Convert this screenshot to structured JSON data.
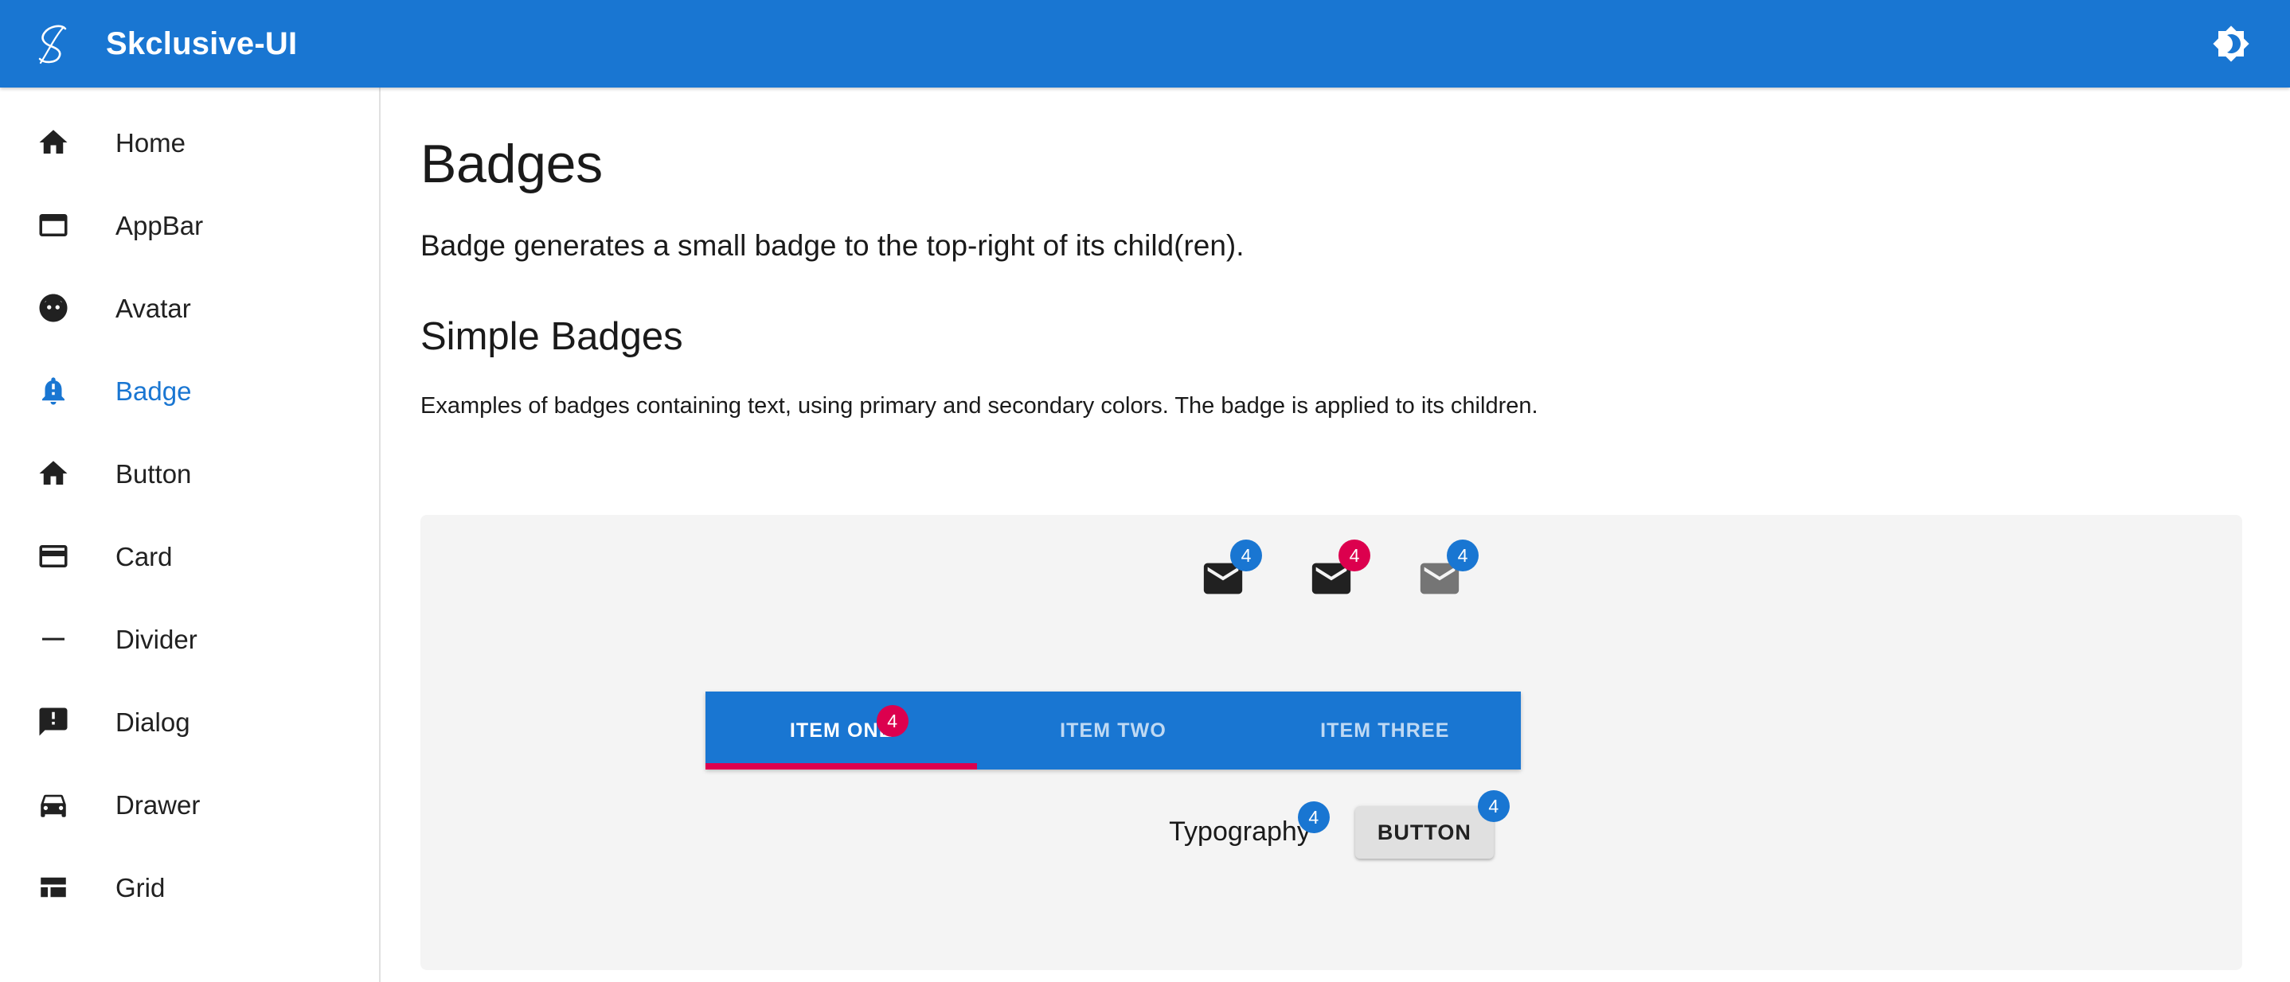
{
  "appbar": {
    "logo_icon": "script-s-logo-icon",
    "title": "Skclusive-UI",
    "theme_toggle_icon": "brightness-dark-mode-icon",
    "background_color": "#1976d2"
  },
  "sidebar": {
    "items": [
      {
        "label": "Home",
        "icon": "home-icon",
        "active": false
      },
      {
        "label": "AppBar",
        "icon": "web-asset-icon",
        "active": false
      },
      {
        "label": "Avatar",
        "icon": "face-icon",
        "active": false
      },
      {
        "label": "Badge",
        "icon": "notification-bell-icon",
        "active": true
      },
      {
        "label": "Button",
        "icon": "home-icon",
        "active": false
      },
      {
        "label": "Card",
        "icon": "credit-card-icon",
        "active": false
      },
      {
        "label": "Divider",
        "icon": "horizontal-rule-icon",
        "active": false
      },
      {
        "label": "Dialog",
        "icon": "comment-alert-icon",
        "active": false
      },
      {
        "label": "Drawer",
        "icon": "directions-car-icon",
        "active": false
      },
      {
        "label": "Grid",
        "icon": "dashboard-grid-icon",
        "active": false
      }
    ],
    "active_color": "#1976d2"
  },
  "main": {
    "page_title": "Badges",
    "page_description": "Badge generates a small badge to the top-right of its child(ren).",
    "section_title": "Simple Badges",
    "section_description": "Examples of badges containing text, using primary and secondary colors. The badge is applied to its children."
  },
  "demo": {
    "mail_badges": [
      {
        "icon": "mail-icon",
        "badge_value": "4",
        "badge_color_name": "primary",
        "badge_color": "#1976d2",
        "icon_state": "normal"
      },
      {
        "icon": "mail-icon",
        "badge_value": "4",
        "badge_color_name": "secondary",
        "badge_color": "#dc004e",
        "icon_state": "normal"
      },
      {
        "icon": "mail-icon",
        "badge_value": "4",
        "badge_color_name": "primary",
        "badge_color": "#1976d2",
        "icon_state": "disabled"
      }
    ],
    "tabs": {
      "items": [
        {
          "label": "ITEM ONE",
          "active": true,
          "badge_value": "4",
          "badge_color": "#dc004e"
        },
        {
          "label": "ITEM TWO",
          "active": false,
          "badge_value": "",
          "badge_color": ""
        },
        {
          "label": "ITEM THREE",
          "active": false,
          "badge_value": "",
          "badge_color": ""
        }
      ],
      "background_color": "#1976d2",
      "indicator_color": "#dc004e"
    },
    "typography": {
      "text": "Typography",
      "badge_value": "4",
      "badge_color": "#1976d2"
    },
    "button": {
      "label": "BUTTON",
      "badge_value": "4",
      "badge_color": "#1976d2"
    },
    "panel_background": "#f4f4f4"
  }
}
